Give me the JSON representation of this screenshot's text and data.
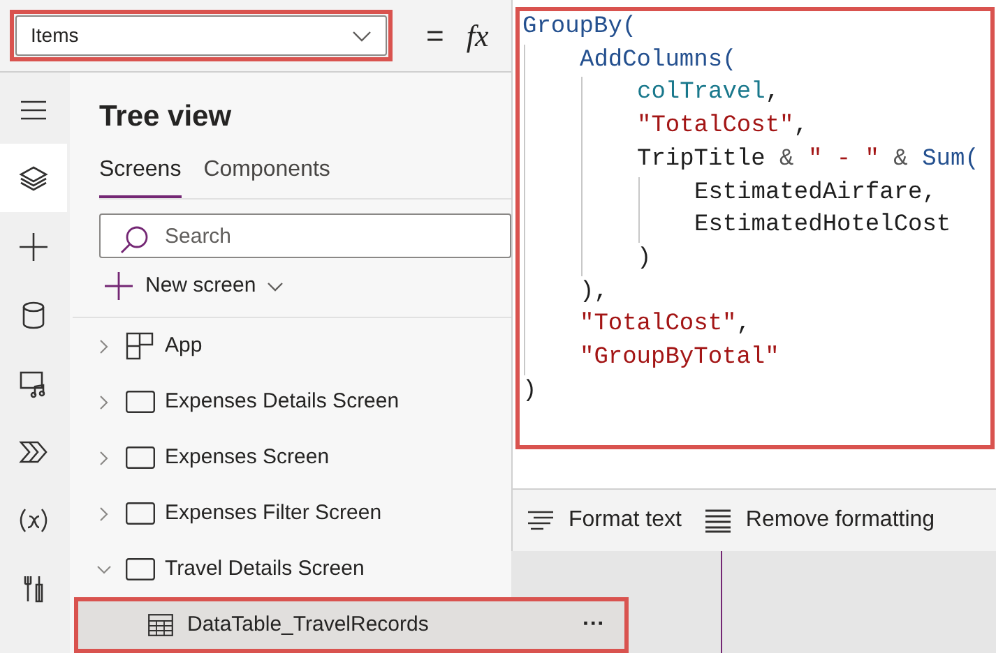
{
  "property_dropdown": {
    "value": "Items"
  },
  "formula_bar": {
    "equals": "=",
    "fx": "fx"
  },
  "rail": [
    {
      "kind": "menu",
      "selected": false
    },
    {
      "kind": "layers",
      "selected": true
    },
    {
      "kind": "plus",
      "selected": false
    },
    {
      "kind": "data",
      "selected": false
    },
    {
      "kind": "media",
      "selected": false
    },
    {
      "kind": "flow",
      "selected": false
    },
    {
      "kind": "variables",
      "selected": false
    },
    {
      "kind": "tools",
      "selected": false
    }
  ],
  "tree_view": {
    "title": "Tree view",
    "tabs": [
      {
        "label": "Screens",
        "selected": true
      },
      {
        "label": "Components",
        "selected": false
      }
    ],
    "search": {
      "placeholder": "Search"
    },
    "new_screen": "New screen",
    "items": [
      {
        "label": "App",
        "kind": "app",
        "expanded": false,
        "selected": false
      },
      {
        "label": "Expenses Details Screen",
        "kind": "screen",
        "expanded": false,
        "selected": false
      },
      {
        "label": "Expenses Screen",
        "kind": "screen",
        "expanded": false,
        "selected": false
      },
      {
        "label": "Expenses Filter Screen",
        "kind": "screen",
        "expanded": false,
        "selected": false
      },
      {
        "label": "Travel Details Screen",
        "kind": "screen",
        "expanded": true,
        "selected": false,
        "children": [
          {
            "label": "DataTable_TravelRecords",
            "kind": "table",
            "selected": true,
            "more": "···"
          }
        ]
      }
    ]
  },
  "formula": {
    "lines": [
      {
        "tokens": [
          {
            "text": "GroupBy(",
            "kind": "function"
          }
        ],
        "children": [
          {
            "tokens": [
              {
                "text": "AddColumns(",
                "kind": "function"
              }
            ],
            "children": [
              {
                "tokens": [
                  {
                    "text": "colTravel",
                    "kind": "variable"
                  },
                  {
                    "text": ",",
                    "kind": "plain"
                  }
                ]
              },
              {
                "tokens": [
                  {
                    "text": "\"TotalCost\"",
                    "kind": "string"
                  },
                  {
                    "text": ",",
                    "kind": "plain"
                  }
                ]
              },
              {
                "tokens": [
                  {
                    "text": "TripTitle ",
                    "kind": "plain"
                  },
                  {
                    "text": "& ",
                    "kind": "operator"
                  },
                  {
                    "text": "\" - \" ",
                    "kind": "string"
                  },
                  {
                    "text": "& ",
                    "kind": "operator"
                  },
                  {
                    "text": "Sum(",
                    "kind": "function"
                  }
                ],
                "children": [
                  {
                    "tokens": [
                      {
                        "text": "EstimatedAirfare,",
                        "kind": "plain"
                      }
                    ]
                  },
                  {
                    "tokens": [
                      {
                        "text": "EstimatedHotelCost",
                        "kind": "plain"
                      }
                    ]
                  }
                ]
              },
              {
                "tokens": [
                  {
                    "text": ")",
                    "kind": "plain"
                  }
                ]
              }
            ]
          },
          {
            "tokens": [
              {
                "text": "),",
                "kind": "plain"
              }
            ]
          },
          {
            "tokens": [
              {
                "text": "\"TotalCost\"",
                "kind": "string"
              },
              {
                "text": ",",
                "kind": "plain"
              }
            ]
          },
          {
            "tokens": [
              {
                "text": "\"GroupByTotal\"",
                "kind": "string"
              }
            ]
          }
        ]
      },
      {
        "tokens": [
          {
            "text": ")",
            "kind": "plain"
          }
        ]
      }
    ],
    "actions": [
      {
        "label": "Format text",
        "kind": "format"
      },
      {
        "label": "Remove formatting",
        "kind": "remove"
      }
    ]
  }
}
